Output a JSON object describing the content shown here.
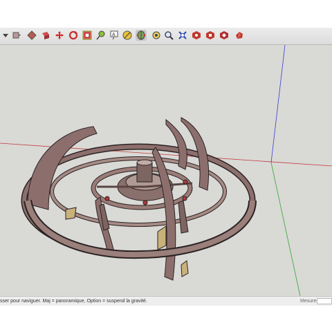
{
  "toolbar": {
    "tools": [
      {
        "name": "select-tool-icon",
        "glyph": "▾"
      },
      {
        "name": "eraser-tool-icon",
        "glyph": "▪"
      },
      {
        "name": "paint-bucket-icon",
        "glyph": "◆"
      },
      {
        "name": "push-pull-icon",
        "glyph": "◈"
      },
      {
        "name": "move-tool-icon",
        "glyph": "✣"
      },
      {
        "name": "rotate-tool-icon",
        "glyph": "↻"
      },
      {
        "name": "scale-tool-icon",
        "glyph": "▣"
      },
      {
        "name": "tape-measure-icon",
        "glyph": "⊸"
      },
      {
        "name": "text-tool-icon",
        "glyph": "A"
      },
      {
        "name": "axes-tool-icon",
        "glyph": "✱"
      },
      {
        "name": "orbit-tool-icon",
        "glyph": "◐"
      },
      {
        "name": "pan-tool-icon",
        "glyph": "✋"
      },
      {
        "name": "zoom-tool-icon",
        "glyph": "⌕"
      },
      {
        "name": "zoom-extents-icon",
        "glyph": "✕"
      },
      {
        "name": "warehouse-icon",
        "glyph": "◉"
      },
      {
        "name": "share-model-icon",
        "glyph": "◉"
      },
      {
        "name": "extension-warehouse-icon",
        "glyph": "◉"
      },
      {
        "name": "ruby-console-icon",
        "glyph": "◆"
      }
    ]
  },
  "statusbar": {
    "text": "sser pour naviguer. Maj = panoramique, Option =  suspend la gravité.",
    "measures_label": "Mesures"
  },
  "colors": {
    "viewport_bg": "#d9d9d6",
    "axis_red": "#c23a3a",
    "axis_green": "#2fa82f",
    "axis_blue": "#3a3ad0",
    "model_fill": "#8c6f6d"
  }
}
